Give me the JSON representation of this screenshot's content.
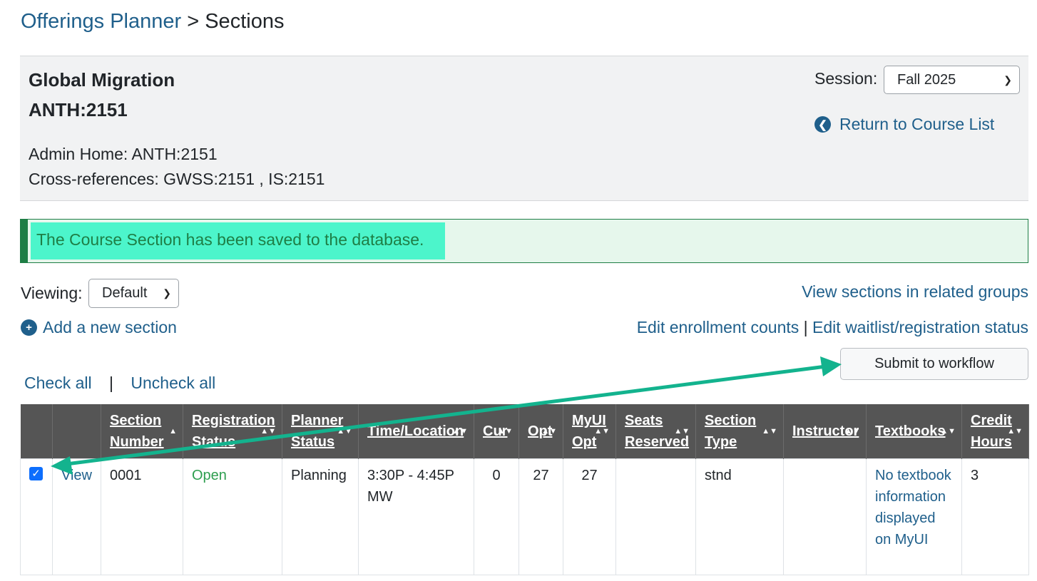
{
  "breadcrumb": {
    "parent": "Offerings Planner",
    "separator": ">",
    "current": "Sections"
  },
  "course": {
    "title": "Global Migration",
    "code": "ANTH:2151",
    "admin_home": "Admin Home: ANTH:2151",
    "cross_references": "Cross-references: GWSS:2151 , IS:2151"
  },
  "session": {
    "label": "Session:",
    "selected": "Fall 2025"
  },
  "return_link": "Return to Course List",
  "alert": {
    "message": "The Course Section has been saved to the database."
  },
  "viewing": {
    "label": "Viewing:",
    "selected": "Default"
  },
  "links": {
    "related_groups": "View sections in related groups",
    "add_section": "Add a new section",
    "edit_enrollment": "Edit enrollment counts",
    "pipe": "|",
    "edit_waitlist": "Edit waitlist/registration status",
    "check_all": "Check all",
    "uncheck_all": "Uncheck all"
  },
  "submit_button": "Submit to workflow",
  "table": {
    "headers": {
      "section_number": [
        "Section",
        "Number"
      ],
      "registration_status": [
        "Registration",
        "Status"
      ],
      "planner_status": [
        "Planner",
        "Status"
      ],
      "time_location": "Time/Location",
      "cur": "Cur",
      "opt": "Opt",
      "myui_opt": [
        "MyUI",
        "Opt"
      ],
      "seats_reserved": [
        "Seats",
        "Reserved"
      ],
      "section_type": [
        "Section",
        "Type"
      ],
      "instructor": "Instructor",
      "textbooks": "Textbooks",
      "credit_hours": [
        "Credit",
        "Hours"
      ]
    },
    "rows": [
      {
        "checked": true,
        "view": "View",
        "section_number": "0001",
        "registration_status": "Open",
        "planner_status": "Planning",
        "time_location": "3:30P - 4:45P MW",
        "cur": "0",
        "opt": "27",
        "myui_opt": "27",
        "seats_reserved": "",
        "section_type": "stnd",
        "instructor": "",
        "textbooks": "No textbook information displayed on MyUI",
        "credit_hours": "3"
      }
    ]
  },
  "colors": {
    "link": "#1f5f8b",
    "header_bg": "#555555",
    "alert_border": "#1e7e45",
    "alert_highlight": "#4cf5cb",
    "annotation_arrow": "#13b38e",
    "open_status": "#2e9e4f"
  }
}
